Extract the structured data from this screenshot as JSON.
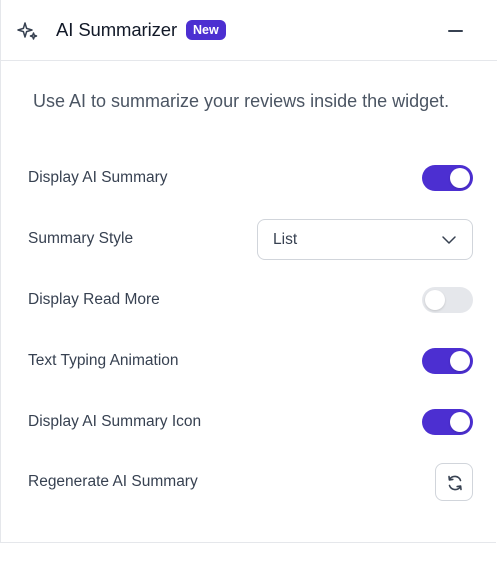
{
  "header": {
    "title": "AI Summarizer",
    "badge": "New",
    "icon": "sparkle-icon",
    "collapse_icon": "minus-icon"
  },
  "description": "Use AI to summarize your reviews inside the widget.",
  "settings": {
    "display_ai_summary": {
      "label": "Display AI Summary",
      "enabled": true
    },
    "summary_style": {
      "label": "Summary Style",
      "value": "List",
      "icon": "chevron-down-icon"
    },
    "display_read_more": {
      "label": "Display Read More",
      "enabled": false
    },
    "text_typing_animation": {
      "label": "Text Typing Animation",
      "enabled": true
    },
    "display_ai_summary_icon": {
      "label": "Display AI Summary Icon",
      "enabled": true
    },
    "regenerate_ai_summary": {
      "label": "Regenerate AI Summary",
      "icon": "refresh-icon"
    }
  },
  "colors": {
    "accent": "#4c2fd1",
    "toggle_off": "#e5e7eb",
    "border": "#e5e7eb"
  }
}
